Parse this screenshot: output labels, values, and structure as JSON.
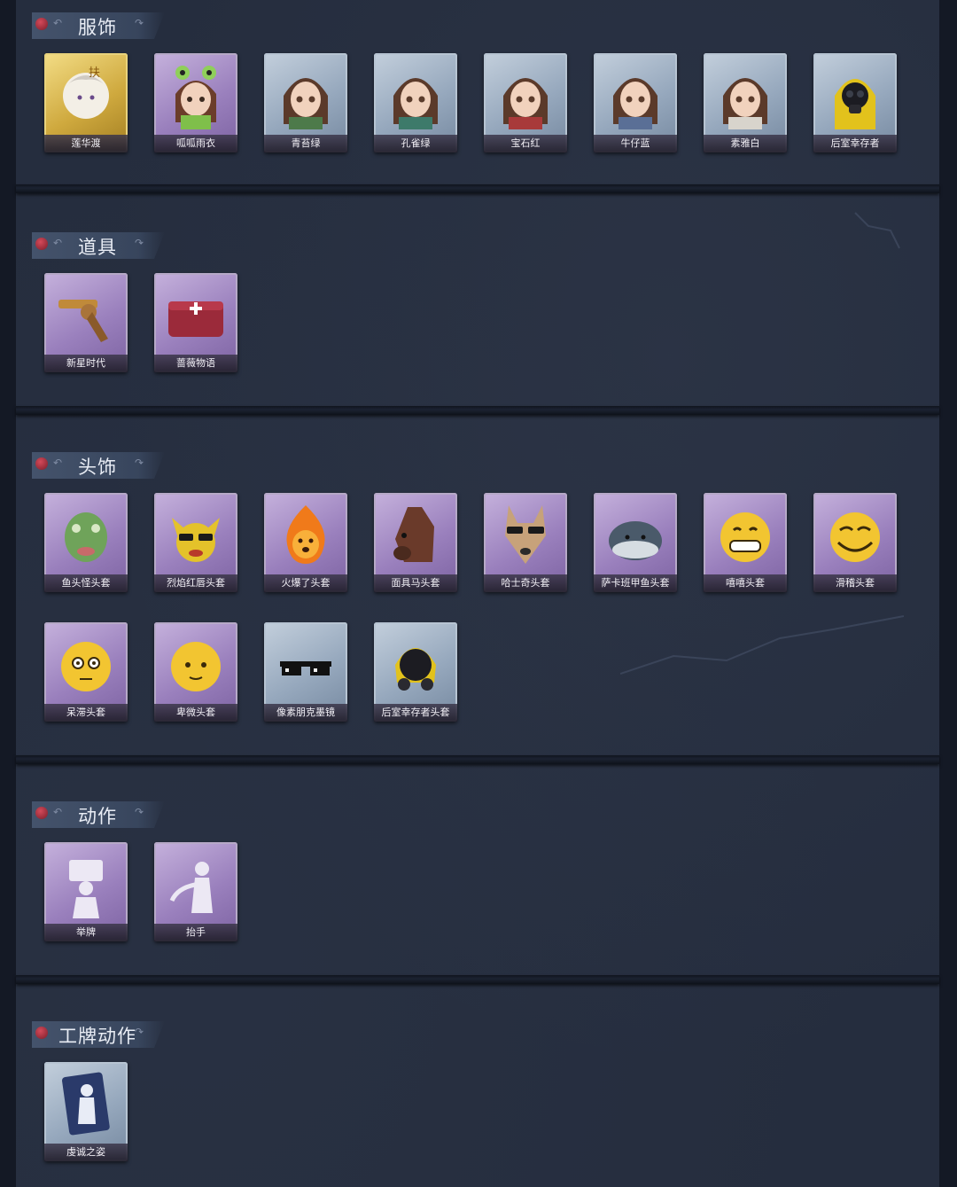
{
  "sections": [
    {
      "title": "服饰",
      "items": [
        {
          "label": "莲华渡",
          "icon": "costume-lianhuadu-icon",
          "rarity": "gold"
        },
        {
          "label": "呱呱雨衣",
          "icon": "costume-frog-raincoat-icon",
          "rarity": "purple"
        },
        {
          "label": "青苔绿",
          "icon": "costume-girl-icon",
          "rarity": "blue"
        },
        {
          "label": "孔雀绿",
          "icon": "costume-girl-icon",
          "rarity": "blue"
        },
        {
          "label": "宝石红",
          "icon": "costume-girl-icon",
          "rarity": "blue"
        },
        {
          "label": "牛仔蓝",
          "icon": "costume-girl-icon",
          "rarity": "blue"
        },
        {
          "label": "素雅白",
          "icon": "costume-girl-icon",
          "rarity": "blue"
        },
        {
          "label": "后室幸存者",
          "icon": "costume-hazmat-icon",
          "rarity": "blue"
        }
      ]
    },
    {
      "title": "道具",
      "items": [
        {
          "label": "新星时代",
          "icon": "revolver-icon",
          "rarity": "purple"
        },
        {
          "label": "蔷薇物语",
          "icon": "medkit-icon",
          "rarity": "purple"
        }
      ]
    },
    {
      "title": "头饰",
      "items": [
        {
          "label": "鱼头怪头套",
          "icon": "fish-head-icon",
          "rarity": "purple"
        },
        {
          "label": "烈焰红唇头套",
          "icon": "duck-sunglasses-icon",
          "rarity": "purple"
        },
        {
          "label": "火爆了头套",
          "icon": "fire-head-icon",
          "rarity": "purple"
        },
        {
          "label": "面具马头套",
          "icon": "horse-head-icon",
          "rarity": "purple"
        },
        {
          "label": "哈士奇头套",
          "icon": "husky-head-icon",
          "rarity": "purple"
        },
        {
          "label": "萨卡班甲鱼头套",
          "icon": "sacabambaspis-head-icon",
          "rarity": "purple"
        },
        {
          "label": "嘻嘻头套",
          "icon": "grin-emoji-icon",
          "rarity": "purple"
        },
        {
          "label": "滑稽头套",
          "icon": "funny-emoji-icon",
          "rarity": "purple"
        },
        {
          "label": "呆滞头套",
          "icon": "dazed-emoji-icon",
          "rarity": "purple"
        },
        {
          "label": "卑微头套",
          "icon": "humble-emoji-icon",
          "rarity": "purple"
        },
        {
          "label": "像素朋克墨镜",
          "icon": "pixel-sunglasses-icon",
          "rarity": "blue"
        },
        {
          "label": "后室幸存者头套",
          "icon": "gas-mask-icon",
          "rarity": "blue"
        }
      ]
    },
    {
      "title": "动作",
      "items": [
        {
          "label": "举牌",
          "icon": "hold-sign-icon",
          "rarity": "purple"
        },
        {
          "label": "抬手",
          "icon": "raise-hand-icon",
          "rarity": "purple"
        }
      ]
    },
    {
      "title": "工牌动作",
      "items": [
        {
          "label": "虔诚之姿",
          "icon": "devout-pose-card-icon",
          "rarity": "blue"
        }
      ]
    }
  ],
  "colors": {
    "background": "#252d3e",
    "purple_card": "#9a80bd",
    "gold_card": "#cfa93e",
    "blue_card": "#96a8bd",
    "label_text": "#f2f0f6"
  }
}
